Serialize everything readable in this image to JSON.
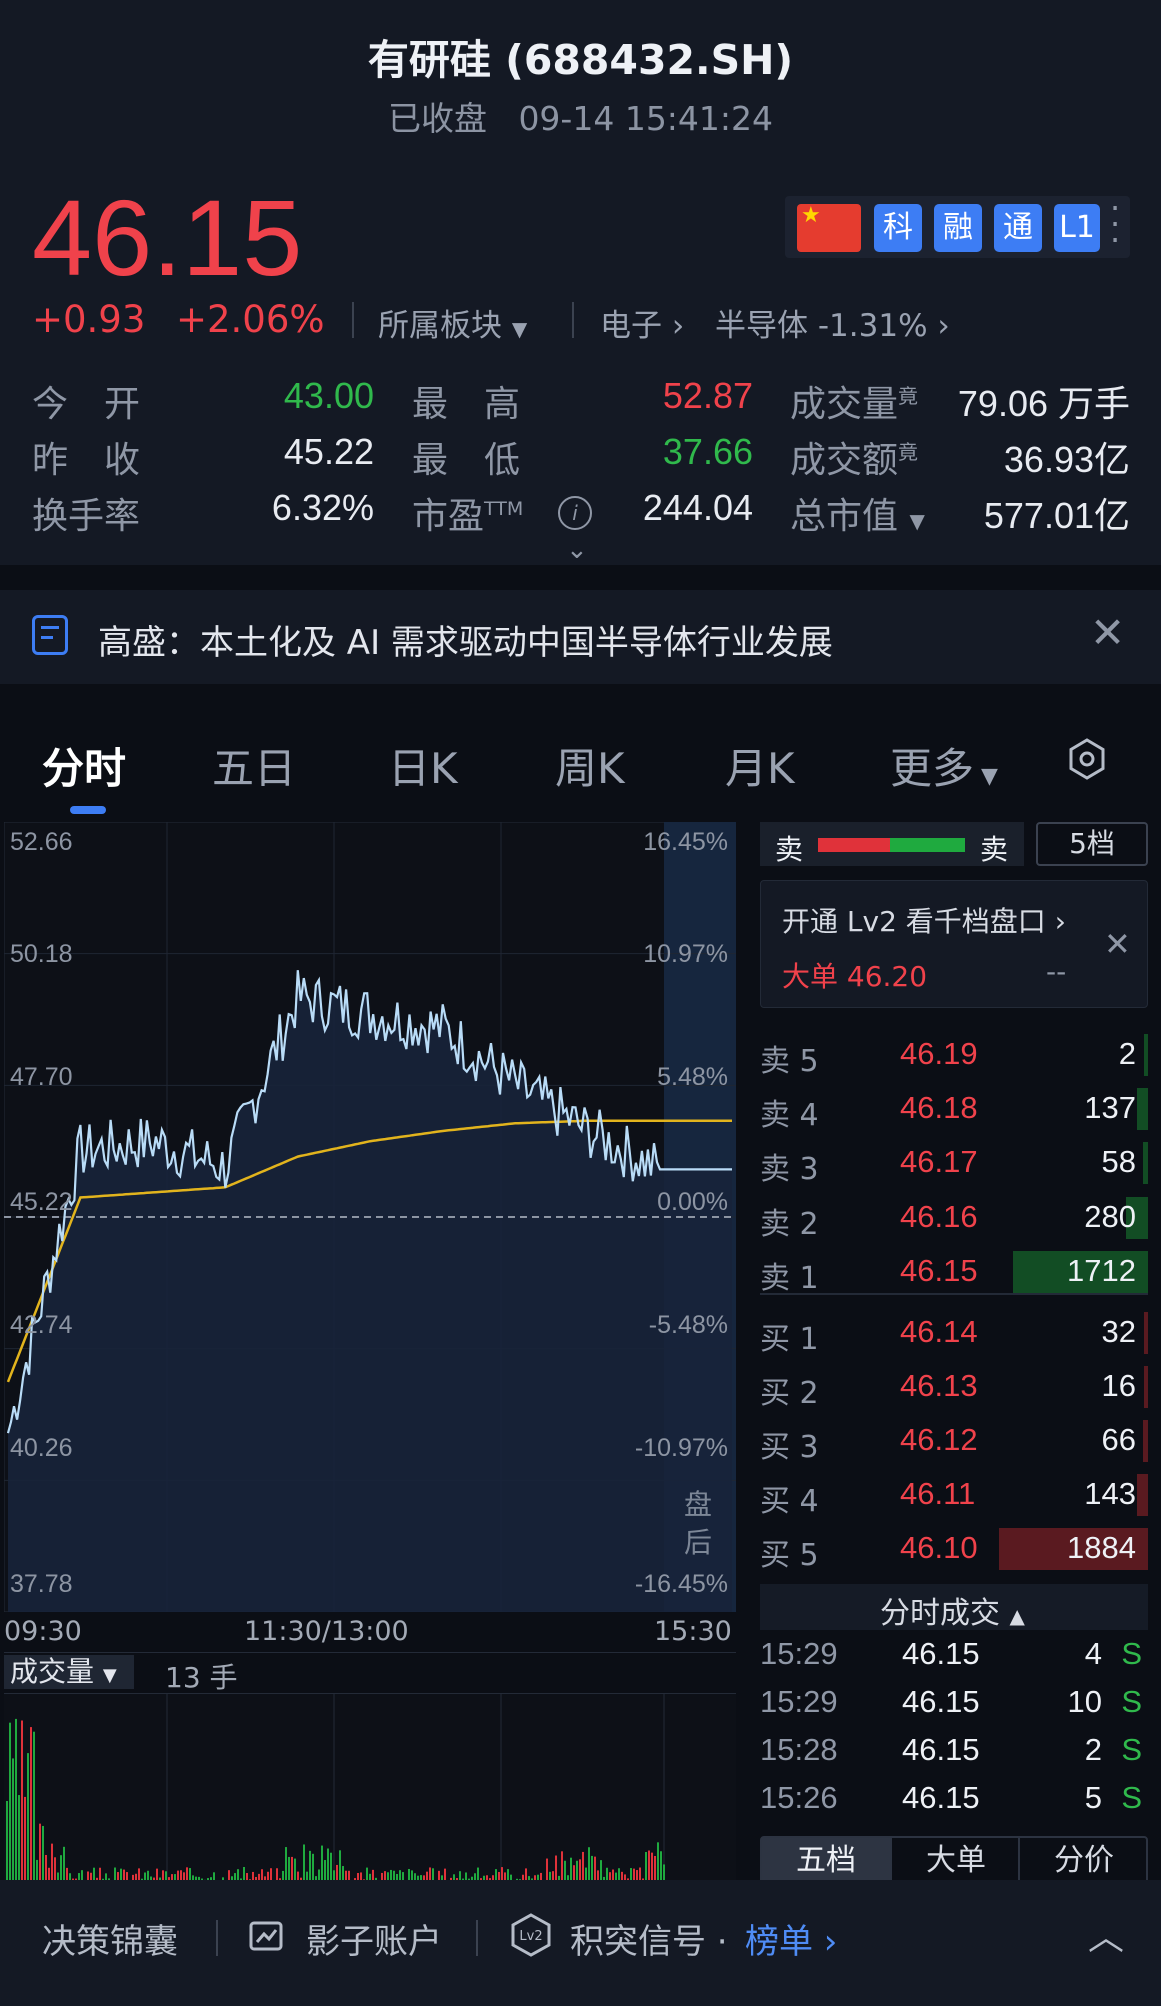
{
  "header": {
    "title": "有研硅 (688432.SH)",
    "status": "已收盘",
    "datetime": "09-14 15:41:24"
  },
  "quote": {
    "price": "46.15",
    "change": "+0.93",
    "change_pct": "+2.06%",
    "sector_label": "所属板块",
    "sector1": "电子",
    "sector2": "半导体 -1.31%",
    "badges": [
      "科",
      "融",
      "通",
      "L1"
    ],
    "rows": [
      {
        "l1": "今　开",
        "v1": "43.00",
        "l2": "最　高",
        "v2": "52.87",
        "l3": "成交量",
        "sup3": "竟",
        "v3": "79.06 万手"
      },
      {
        "l1": "昨　收",
        "v1": "45.22",
        "l2": "最　低",
        "v2": "37.66",
        "l3": "成交额",
        "sup3": "竟",
        "v3": "36.93亿"
      },
      {
        "l1": "换手率",
        "v1": "6.32%",
        "l2": "市盈",
        "sup2": "TTM",
        "v2": "244.04",
        "l3": "总市值",
        "v3": "577.01亿"
      }
    ]
  },
  "news": {
    "text": "高盛：本土化及 AI 需求驱动中国半导体行业发展"
  },
  "tabs": [
    "分时",
    "五日",
    "日K",
    "周K",
    "月K",
    "更多"
  ],
  "chart": {
    "left_ticks": [
      "52.66",
      "50.18",
      "47.70",
      "45.22",
      "42.74",
      "40.26",
      "37.78"
    ],
    "right_ticks": [
      "16.45%",
      "10.97%",
      "5.48%",
      "0.00%",
      "-5.48%",
      "-10.97%",
      "-16.45%"
    ],
    "time_labels": [
      "09:30",
      "11:30/13:00",
      "15:30"
    ],
    "after_hours": "盘\n后",
    "volume_label": "成交量",
    "volume_value": "13 手",
    "price_colors": {
      "price": "#b9dcf7",
      "avg": "#e2b41d"
    }
  },
  "chart_data": {
    "type": "line",
    "x": [
      "09:30",
      "10:00",
      "10:30",
      "11:00",
      "11:30/13:00",
      "13:30",
      "14:00",
      "14:30",
      "15:00",
      "15:30"
    ],
    "series": [
      {
        "values": [
          41.0,
          46.5,
          46.7,
          46.2,
          49.5,
          49.2,
          48.9,
          47.8,
          46.9,
          46.15
        ]
      },
      {
        "values": [
          42.0,
          45.6,
          45.7,
          45.8,
          46.4,
          46.7,
          46.9,
          47.05,
          47.1,
          47.1
        ]
      }
    ],
    "ylim": [
      37.78,
      52.66
    ]
  },
  "orderbook": {
    "header_left": "卖",
    "header_right": "卖",
    "levels_btn": "5档",
    "promo": "开通 Lv2 看千档盘口",
    "big_order": "大单 46.20",
    "big_dash": "--",
    "asks": [
      {
        "label": "卖 5",
        "price": "46.19",
        "qty": "2"
      },
      {
        "label": "卖 4",
        "price": "46.18",
        "qty": "137"
      },
      {
        "label": "卖 3",
        "price": "46.17",
        "qty": "58"
      },
      {
        "label": "卖 2",
        "price": "46.16",
        "qty": "280"
      },
      {
        "label": "卖 1",
        "price": "46.15",
        "qty": "1712"
      }
    ],
    "bids": [
      {
        "label": "买 1",
        "price": "46.14",
        "qty": "32"
      },
      {
        "label": "买 2",
        "price": "46.13",
        "qty": "16"
      },
      {
        "label": "买 3",
        "price": "46.12",
        "qty": "66"
      },
      {
        "label": "买 4",
        "price": "46.11",
        "qty": "143"
      },
      {
        "label": "买 5",
        "price": "46.10",
        "qty": "1884"
      }
    ],
    "trades_title": "分时成交",
    "trades": [
      {
        "time": "15:29",
        "price": "46.15",
        "qty": "4",
        "side": "S"
      },
      {
        "time": "15:29",
        "price": "46.15",
        "qty": "10",
        "side": "S"
      },
      {
        "time": "15:28",
        "price": "46.15",
        "qty": "2",
        "side": "S"
      },
      {
        "time": "15:26",
        "price": "46.15",
        "qty": "5",
        "side": "S"
      }
    ],
    "bottom_tabs": [
      "五档",
      "大单",
      "分价"
    ]
  },
  "bottom_bar": {
    "item1": "决策锦囊",
    "item2": "影子账户",
    "item3": "积突信号 ·",
    "item3_link": "榜单"
  }
}
